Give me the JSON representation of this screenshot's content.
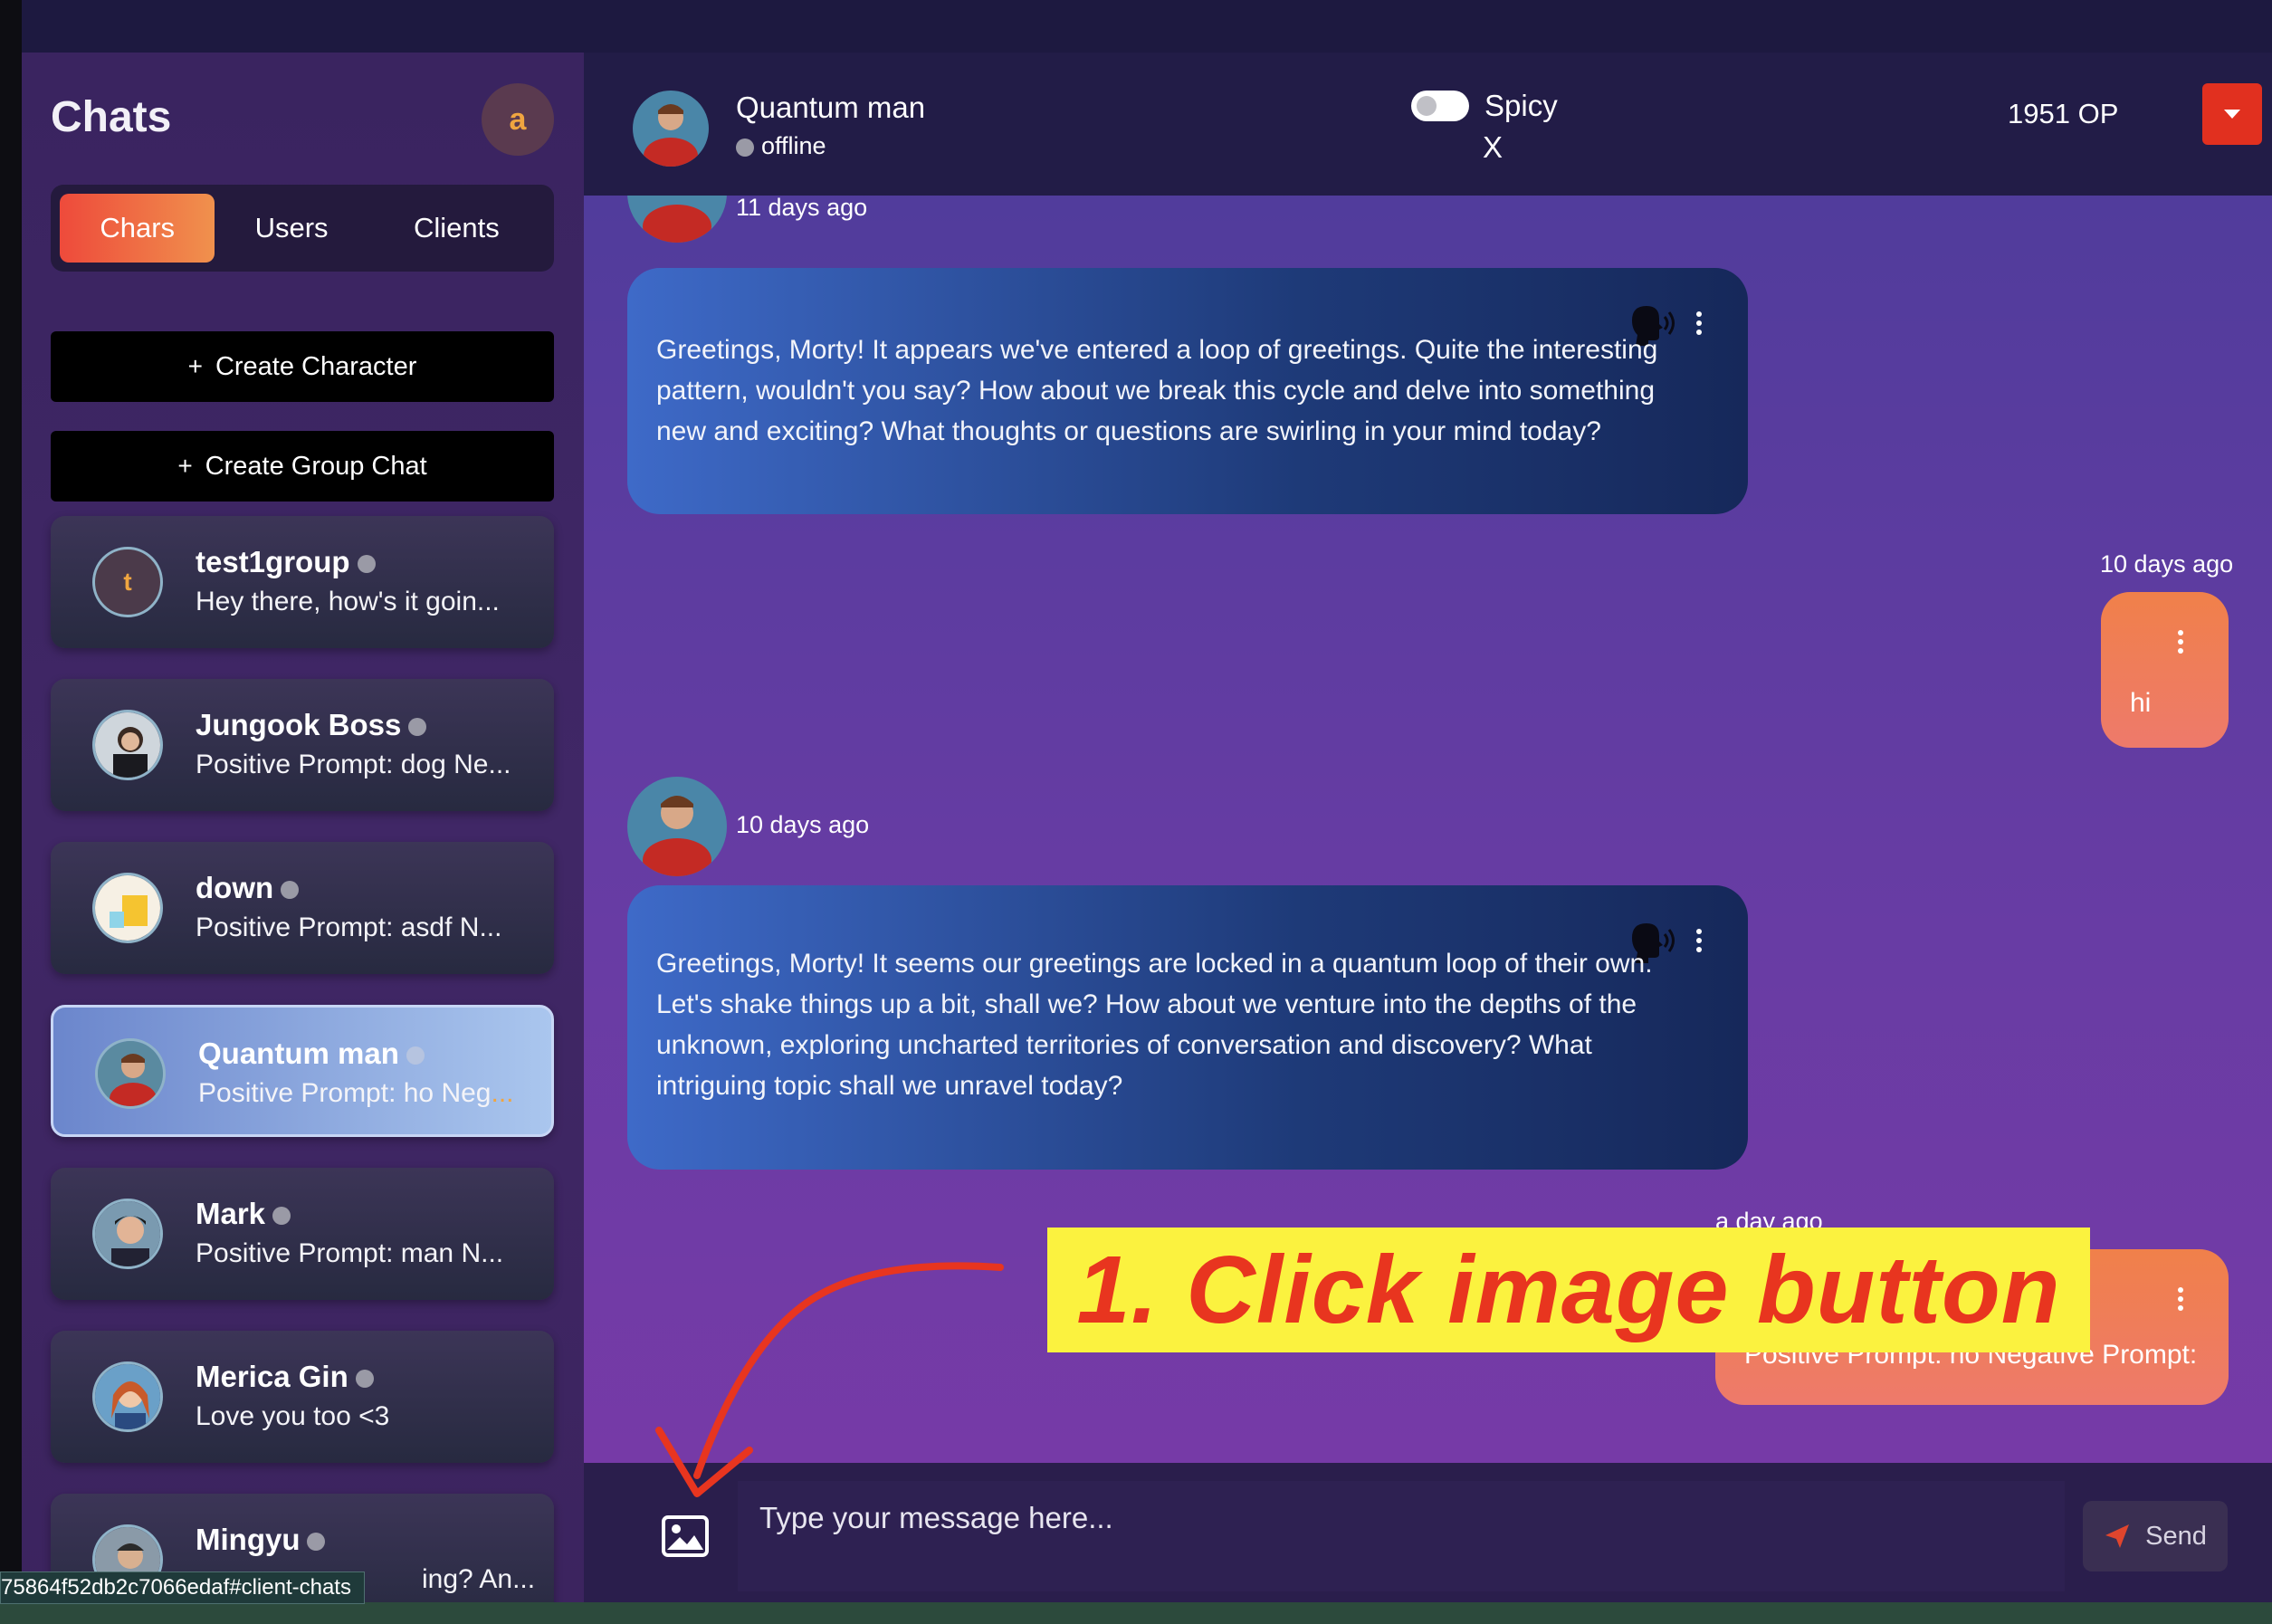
{
  "sidebar": {
    "title": "Chats",
    "user_initial": "a",
    "tabs": [
      "Chars",
      "Users",
      "Clients"
    ],
    "create_character": "Create Character",
    "create_group_chat": "Create Group Chat",
    "chats": [
      {
        "name": "test1group",
        "preview": "Hey there, how's it goin...",
        "initial": "t"
      },
      {
        "name": "Jungook Boss",
        "preview": "Positive Prompt: dog Ne..."
      },
      {
        "name": "down",
        "preview": "Positive Prompt: asdf N..."
      },
      {
        "name": "Quantum man",
        "preview_main": "Positive Prompt: ho Neg",
        "preview_tail": "..."
      },
      {
        "name": "Mark",
        "preview": "Positive Prompt: man N..."
      },
      {
        "name": "Merica Gin",
        "preview": "Love you too <3"
      },
      {
        "name": "Mingyu",
        "preview": "ing? An..."
      }
    ],
    "status_url": "75864f52db2c7066edaf#client-chats"
  },
  "header": {
    "name": "Quantum man",
    "status": "offline",
    "toggle_label": "Spicy",
    "close_label": "X",
    "points": "1951 OP"
  },
  "messages": [
    {
      "timestamp": "11 days ago",
      "text": "Greetings, Morty! It appears we've entered a loop of greetings. Quite the interesting pattern, wouldn't you say? How about we break this cycle and delve into something new and exciting? What thoughts or questions are swirling in your mind today?"
    },
    {
      "timestamp": "10 days ago",
      "text": "hi"
    },
    {
      "timestamp": "10 days ago",
      "text": "Greetings, Morty! It seems our greetings are locked in a quantum loop of their own. Let's shake things up a bit, shall we? How about we venture into the depths of the unknown, exploring uncharted territories of conversation and discovery? What intriguing topic shall we unravel today?"
    },
    {
      "timestamp": "a day ago",
      "text": "Positive Prompt: no Negative Prompt:"
    }
  ],
  "composer": {
    "placeholder": "Type your message here...",
    "send_label": "Send"
  },
  "annotation": {
    "text": "1. Click image button"
  }
}
